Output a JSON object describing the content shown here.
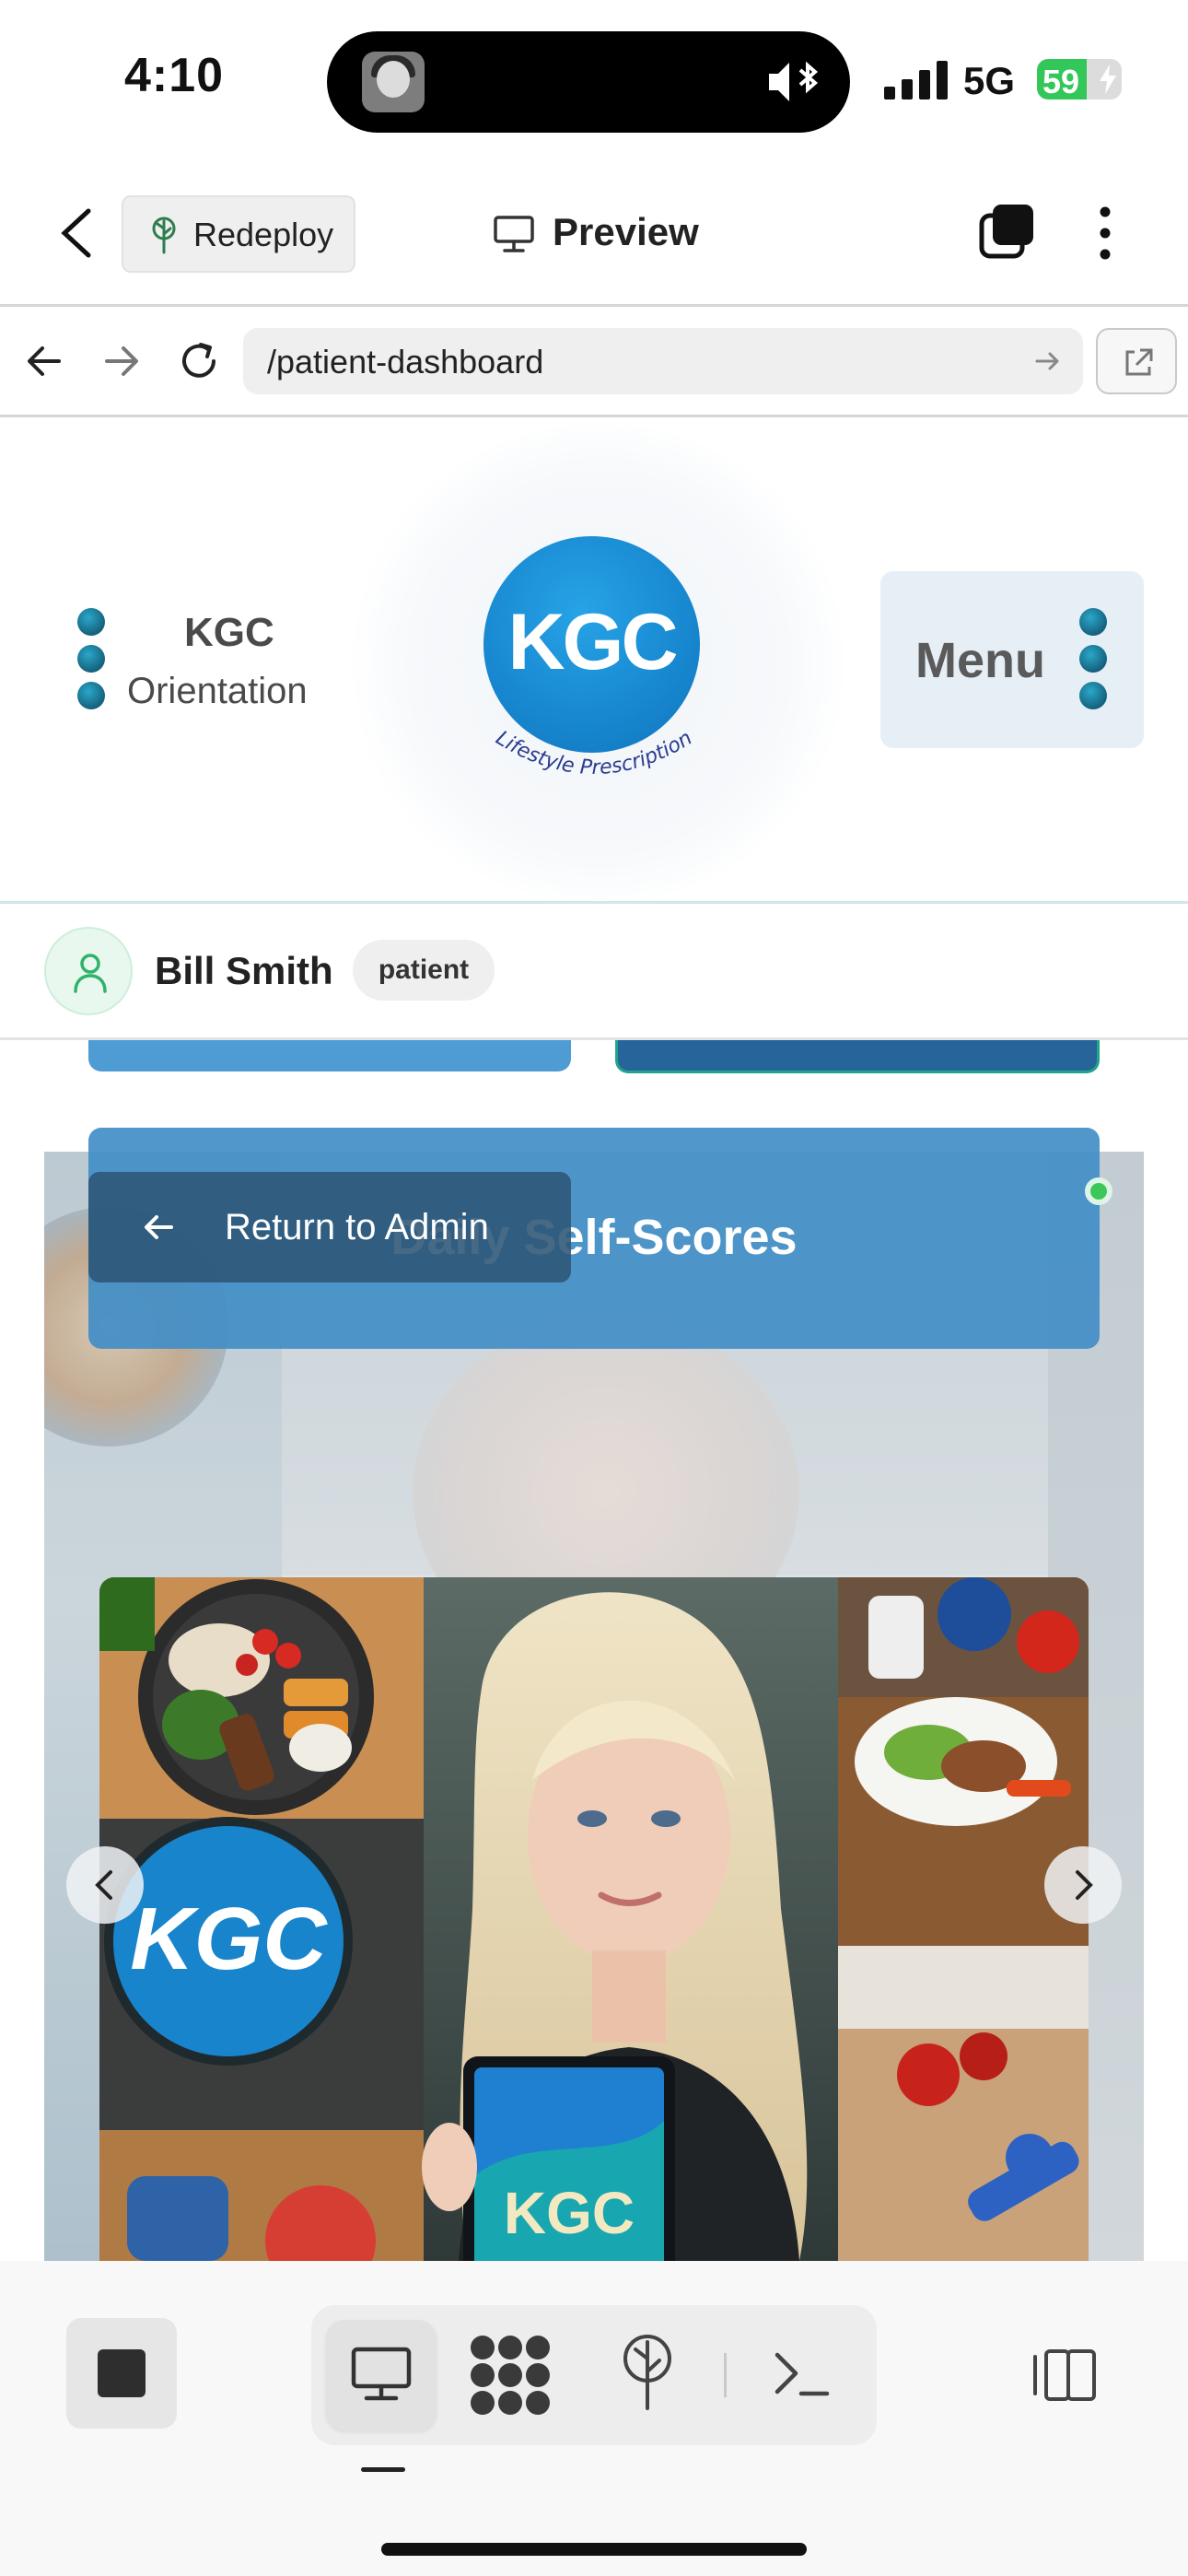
{
  "status_bar": {
    "time": "4:10",
    "network": "5G",
    "battery_percent": 59
  },
  "app_bar": {
    "redeploy_label": "Redeploy",
    "preview_label": "Preview"
  },
  "url_bar": {
    "path": "/patient-dashboard"
  },
  "site_header": {
    "orientation_line1": "KGC",
    "orientation_line2": "Orientation",
    "logo_text": "KGC",
    "logo_tagline": "Lifestyle Prescription",
    "menu_label": "Menu"
  },
  "user": {
    "name": "Bill Smith",
    "role": "patient"
  },
  "content": {
    "score_title": "Daily Self-Scores",
    "return_label": "Return to Admin",
    "hero_logo_text": "KGC",
    "tablet_logo_text": "KGC"
  },
  "colors": {
    "brand_blue": "#1787cf",
    "teal_dot": "#15627e",
    "score_bar": "#428ec7",
    "success_green": "#33c759"
  },
  "icons": {
    "topbar_back": "chevron-left-icon",
    "redeploy": "deploy-tree-icon",
    "preview": "monitor-icon",
    "tabs": "tabs-icon",
    "more": "kebab-icon",
    "nav_back": "arrow-left-icon",
    "nav_forward": "arrow-right-icon",
    "reload": "reload-icon",
    "open_external": "external-link-icon",
    "user": "user-icon",
    "return": "arrow-left-icon",
    "carousel_prev": "chevron-left-icon",
    "carousel_next": "chevron-right-icon",
    "stop": "stop-icon",
    "desktop": "monitor-icon",
    "apps": "apps-grid-icon",
    "deploy": "deploy-tree-icon",
    "terminal": "terminal-icon",
    "layout": "layout-toggle-icon"
  }
}
